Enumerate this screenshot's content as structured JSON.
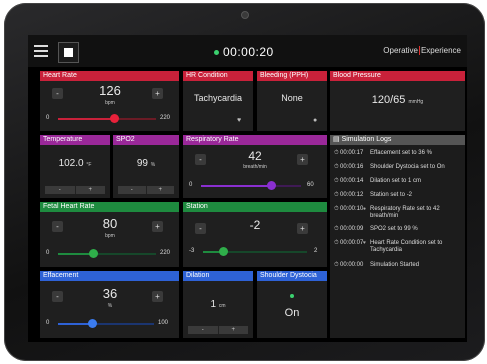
{
  "topbar": {
    "timer": "00:00:20",
    "logo_left": "Operative",
    "logo_right": "Experience",
    "timer_dot_color": "#3bd16f"
  },
  "heart_rate": {
    "title": "Heart Rate",
    "value": "126",
    "unit": "bpm",
    "min": "0",
    "max": "220",
    "level": 0.573,
    "minus": "-",
    "plus": "+"
  },
  "hr_condition": {
    "title": "HR Condition",
    "value": "Tachycardia",
    "icon": "heart-icon"
  },
  "bleeding": {
    "title": "Bleeding (PPH)",
    "value": "None",
    "icon": "drop-icon"
  },
  "blood_pressure": {
    "title": "Blood Pressure",
    "value": "120/65",
    "unit": "mmHg"
  },
  "temperature": {
    "title": "Temperature",
    "value": "102.0",
    "unit": "°F",
    "minus": "-",
    "plus": "+"
  },
  "spo2": {
    "title": "SPO2",
    "value": "99",
    "unit": "%",
    "minus": "-",
    "plus": "+"
  },
  "respiratory_rate": {
    "title": "Respiratory Rate",
    "value": "42",
    "unit": "breath/min",
    "min": "0",
    "max": "60",
    "level": 0.7,
    "minus": "-",
    "plus": "+"
  },
  "fetal_heart_rate": {
    "title": "Fetal Heart Rate",
    "value": "80",
    "unit": "bpm",
    "min": "0",
    "max": "220",
    "level": 0.364,
    "minus": "-",
    "plus": "+"
  },
  "station": {
    "title": "Station",
    "value": "-2",
    "min": "-3",
    "max": "2",
    "level": 0.2,
    "minus": "-",
    "plus": "+"
  },
  "effacement": {
    "title": "Effacement",
    "value": "36",
    "unit": "%",
    "min": "0",
    "max": "100",
    "level": 0.36,
    "minus": "-",
    "plus": "+"
  },
  "dilation": {
    "title": "Dilation",
    "value": "1",
    "unit": "cm",
    "minus": "-",
    "plus": "+"
  },
  "shoulder_dystocia": {
    "title": "Shoulder Dystocia",
    "value": "On",
    "indicator_color": "#3bd16f"
  },
  "colors": {
    "red": "#c9213a",
    "purple": "#9a2899",
    "green": "#1e8b3f",
    "blue": "#2e62d6",
    "red_knob": "#e8213a",
    "purple_knob": "#8a2fd0",
    "green_knob": "#2fae4a",
    "blue_knob": "#3b7cf0"
  },
  "logs": {
    "title": "Simulation Logs",
    "entries": [
      {
        "time": "00:00:17",
        "message": "Effacement set to 36 %"
      },
      {
        "time": "00:00:16",
        "message": "Shoulder Dystocia set to On"
      },
      {
        "time": "00:00:14",
        "message": "Dilation set to 1 cm"
      },
      {
        "time": "00:00:12",
        "message": "Station set to -2"
      },
      {
        "time": "00:00:10",
        "message": "Respiratory Rate set to 42 breath/min",
        "icon": "pin-icon"
      },
      {
        "time": "00:00:09",
        "message": "SPO2 set to 99 %"
      },
      {
        "time": "00:00:07",
        "message": "Heart Rate Condition set to Tachycardia",
        "icon": "heart-icon"
      },
      {
        "time": "00:00:00",
        "message": "Simulation Started"
      }
    ]
  }
}
